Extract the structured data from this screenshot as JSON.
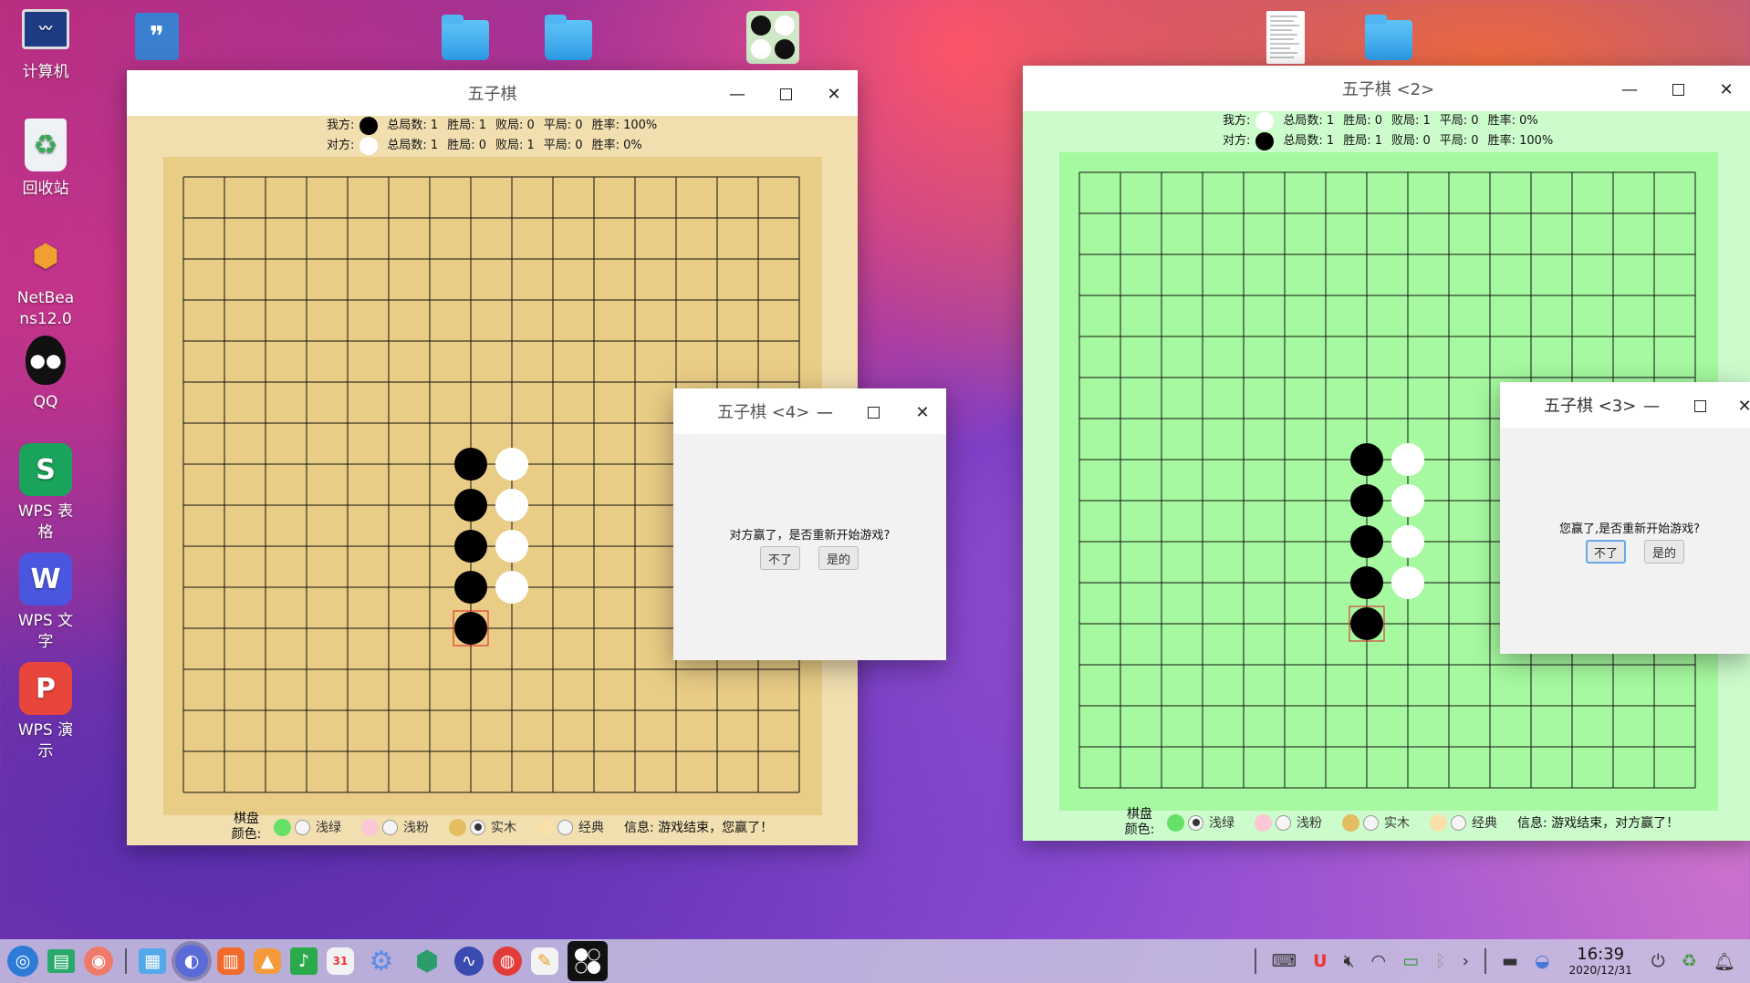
{
  "desktop": {
    "icons": [
      {
        "label": "计算机",
        "icon": "computer-icon",
        "color": "#2a4a9a"
      },
      {
        "label": "回收站",
        "icon": "recycle-bin-icon",
        "color": "#e9eef2"
      },
      {
        "label": "NetBea\nns12.0",
        "icon": "netbeans-icon",
        "color": "#ffffff"
      },
      {
        "label": "QQ",
        "icon": "qq-icon",
        "color": "#ffffff"
      },
      {
        "label": "WPS 表\n格",
        "icon": "wps-sheet-icon",
        "color": "#1aa35a"
      },
      {
        "label": "WPS 文\n字",
        "icon": "wps-writer-icon",
        "color": "#4a56e0"
      },
      {
        "label": "WPS 演\n示",
        "icon": "wps-presentation-icon",
        "color": "#e8453c"
      }
    ]
  },
  "window1": {
    "title": "五子棋",
    "me_label": "我方:",
    "opp_label": "对方:",
    "me_stats": [
      "总局数: 1",
      "胜局: 1",
      "败局: 0",
      "平局: 0",
      "胜率: 100%"
    ],
    "opp_stats": [
      "总局数: 1",
      "胜局: 0",
      "败局: 1",
      "平局: 0",
      "胜率: 0%"
    ],
    "board_color": "#e9cc85",
    "bg_color": "#f1dfb0",
    "bottom_label": "棋盘\n颜色:",
    "options": [
      "浅绿",
      "浅粉",
      "实木",
      "经典"
    ],
    "selected": 2,
    "info": "信息: 游戏结束，您赢了！"
  },
  "window2": {
    "title": "五子棋 <2>",
    "me_label": "我方:",
    "opp_label": "对方:",
    "me_stats": [
      "总局数: 1",
      "胜局: 0",
      "败局: 1",
      "平局: 0",
      "胜率: 0%"
    ],
    "opp_stats": [
      "总局数: 1",
      "胜局: 1",
      "败局: 0",
      "平局: 0",
      "胜率: 100%"
    ],
    "board_color": "#a6f9a0",
    "bg_color": "#ccfccc",
    "bottom_label": "棋盘\n颜色:",
    "options": [
      "浅绿",
      "浅粉",
      "实木",
      "经典"
    ],
    "selected": 0,
    "info": "信息: 游戏结束，对方赢了！"
  },
  "dialog4": {
    "title": "五子棋 <4>",
    "message": "对方赢了，是否重新开始游戏?",
    "no": "不了",
    "yes": "是的"
  },
  "dialog3": {
    "title": "五子棋 <3>",
    "message": "您赢了,是否重新开始游戏?",
    "no": "不了",
    "yes": "是的"
  },
  "taskbar": {
    "time": "16:39",
    "date": "2020/12/31"
  }
}
